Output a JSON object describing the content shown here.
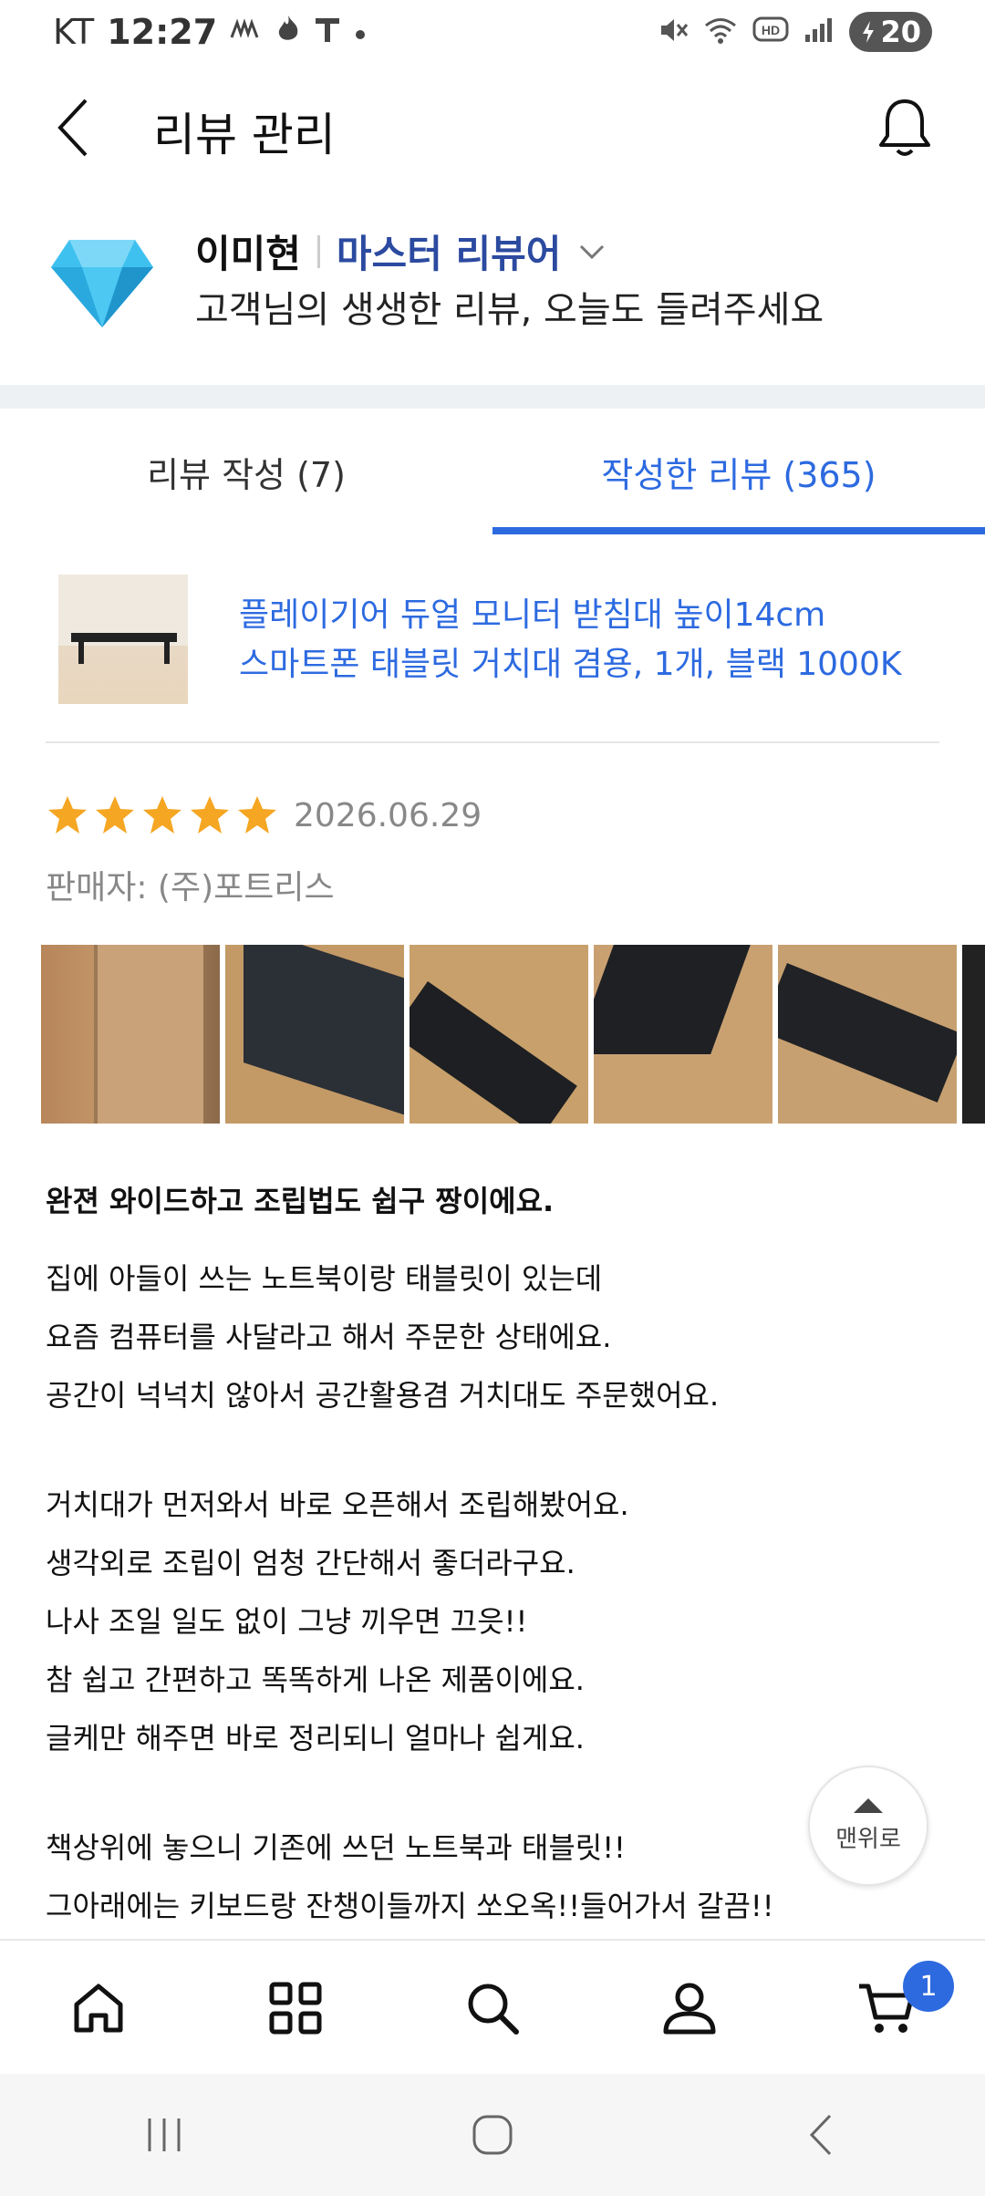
{
  "status_bar": {
    "carrier": "KT",
    "time": "12:27",
    "battery": "20"
  },
  "header": {
    "title": "리뷰 관리"
  },
  "profile": {
    "name": "이미현",
    "grade": "마스터 리뷰어",
    "message": "고객님의 생생한 리뷰, 오늘도 들려주세요"
  },
  "tabs": [
    {
      "label": "리뷰 작성 (7)",
      "active": false
    },
    {
      "label": "작성한 리뷰 (365)",
      "active": true
    }
  ],
  "product": {
    "name_line1": "플레이기어 듀얼 모니터 받침대 높이14cm",
    "name_line2": "스마트폰 태블릿 거치대 겸용, 1개, 블랙 1000K"
  },
  "review": {
    "rating": 5,
    "date": "2026.06.29",
    "seller": "판매자: (주)포트리스",
    "title": "완젼 와이드하고 조립법도 쉽구 짱이에요.",
    "lines": [
      "집에 아들이 쓰는 노트북이랑 태블릿이 있는데",
      "요즘 컴퓨터를 사달라고 해서 주문한 상태에요.",
      "공간이 넉넉치 않아서 공간활용겸 거치대도 주문했어요.",
      "",
      "거치대가 먼저와서 바로 오픈해서 조립해봤어요.",
      "생각외로 조립이 엄청 간단해서 좋더라구요.",
      "나사 조일 일도 없이 그냥 끼우면 끄읏!!",
      "참 쉽고 간편하고 똑똑하게 나온 제품이에요.",
      "글케만 해주면 바로 정리되니 얼마나 쉽게요.",
      "",
      "책상위에 놓으니 기존에 쓰던 노트북과 태블릿!!",
      "그아래에는 키보드랑 잔챙이들까지 쏘오옥!!들어가서 갈끔!!"
    ]
  },
  "scroll_top": {
    "label": "맨위로"
  },
  "bottom_nav": {
    "items": [
      "home-icon",
      "category-icon",
      "search-icon",
      "user-icon",
      "cart-icon"
    ],
    "cart_badge": "1"
  },
  "colors": {
    "accent": "#2d6ae0",
    "grade": "#2b4aa0",
    "star": "#f5a623"
  }
}
